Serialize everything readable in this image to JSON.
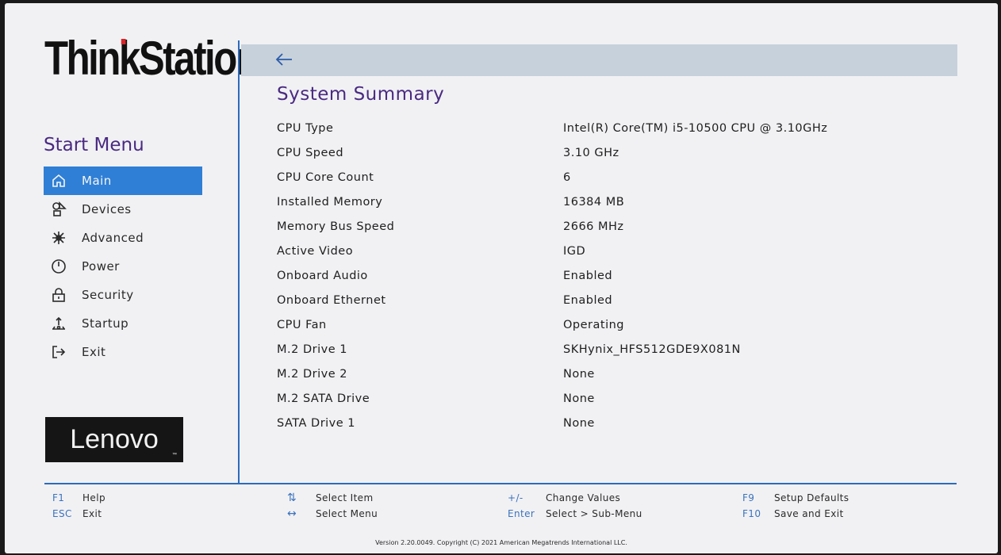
{
  "brand": {
    "name": "ThinkStation",
    "vendor_logo": "Lenovo"
  },
  "start_menu": {
    "title": "Start Menu",
    "items": [
      {
        "label": "Main",
        "icon": "home-icon"
      },
      {
        "label": "Devices",
        "icon": "devices-icon"
      },
      {
        "label": "Advanced",
        "icon": "advanced-icon"
      },
      {
        "label": "Power",
        "icon": "power-icon"
      },
      {
        "label": "Security",
        "icon": "lock-icon"
      },
      {
        "label": "Startup",
        "icon": "startup-icon"
      },
      {
        "label": "Exit",
        "icon": "exit-icon"
      }
    ],
    "selected": "Main"
  },
  "main": {
    "title": "System Summary",
    "rows": [
      {
        "label": "CPU Type",
        "value": "Intel(R) Core(TM) i5-10500 CPU @ 3.10GHz"
      },
      {
        "label": "CPU Speed",
        "value": "3.10 GHz"
      },
      {
        "label": "CPU Core Count",
        "value": "6"
      },
      {
        "label": "Installed Memory",
        "value": "16384 MB"
      },
      {
        "label": "Memory Bus Speed",
        "value": "2666 MHz"
      },
      {
        "label": "Active Video",
        "value": "IGD"
      },
      {
        "label": "Onboard Audio",
        "value": "Enabled"
      },
      {
        "label": "Onboard Ethernet",
        "value": "Enabled"
      },
      {
        "label": "CPU Fan",
        "value": "Operating"
      },
      {
        "label": "M.2 Drive 1",
        "value": "SKHynix_HFS512GDE9X081N"
      },
      {
        "label": "M.2 Drive 2",
        "value": "None"
      },
      {
        "label": "M.2 SATA Drive",
        "value": "None"
      },
      {
        "label": "SATA Drive 1",
        "value": "None"
      }
    ]
  },
  "footer": {
    "keys": [
      [
        {
          "key": "F1",
          "desc": "Help"
        },
        {
          "key": "ESC",
          "desc": "Exit"
        }
      ],
      [
        {
          "key": "⇅",
          "desc": "Select Item"
        },
        {
          "key": "↔",
          "desc": "Select Menu"
        }
      ],
      [
        {
          "key": "+/-",
          "desc": "Change Values"
        },
        {
          "key": "Enter",
          "desc": "Select > Sub-Menu"
        }
      ],
      [
        {
          "key": "F9",
          "desc": "Setup Defaults"
        },
        {
          "key": "F10",
          "desc": "Save and Exit"
        }
      ]
    ],
    "copyright": "Version 2.20.0049. Copyright (C) 2021 American Megatrends International LLC."
  },
  "colors": {
    "accent_purple": "#4a2a80",
    "selection_blue": "#2f7fd6",
    "divider_blue": "#2b6bbd",
    "key_blue": "#3c73bd",
    "header_bar": "#c7d1db",
    "brand_red_dot": "#d4262b"
  }
}
